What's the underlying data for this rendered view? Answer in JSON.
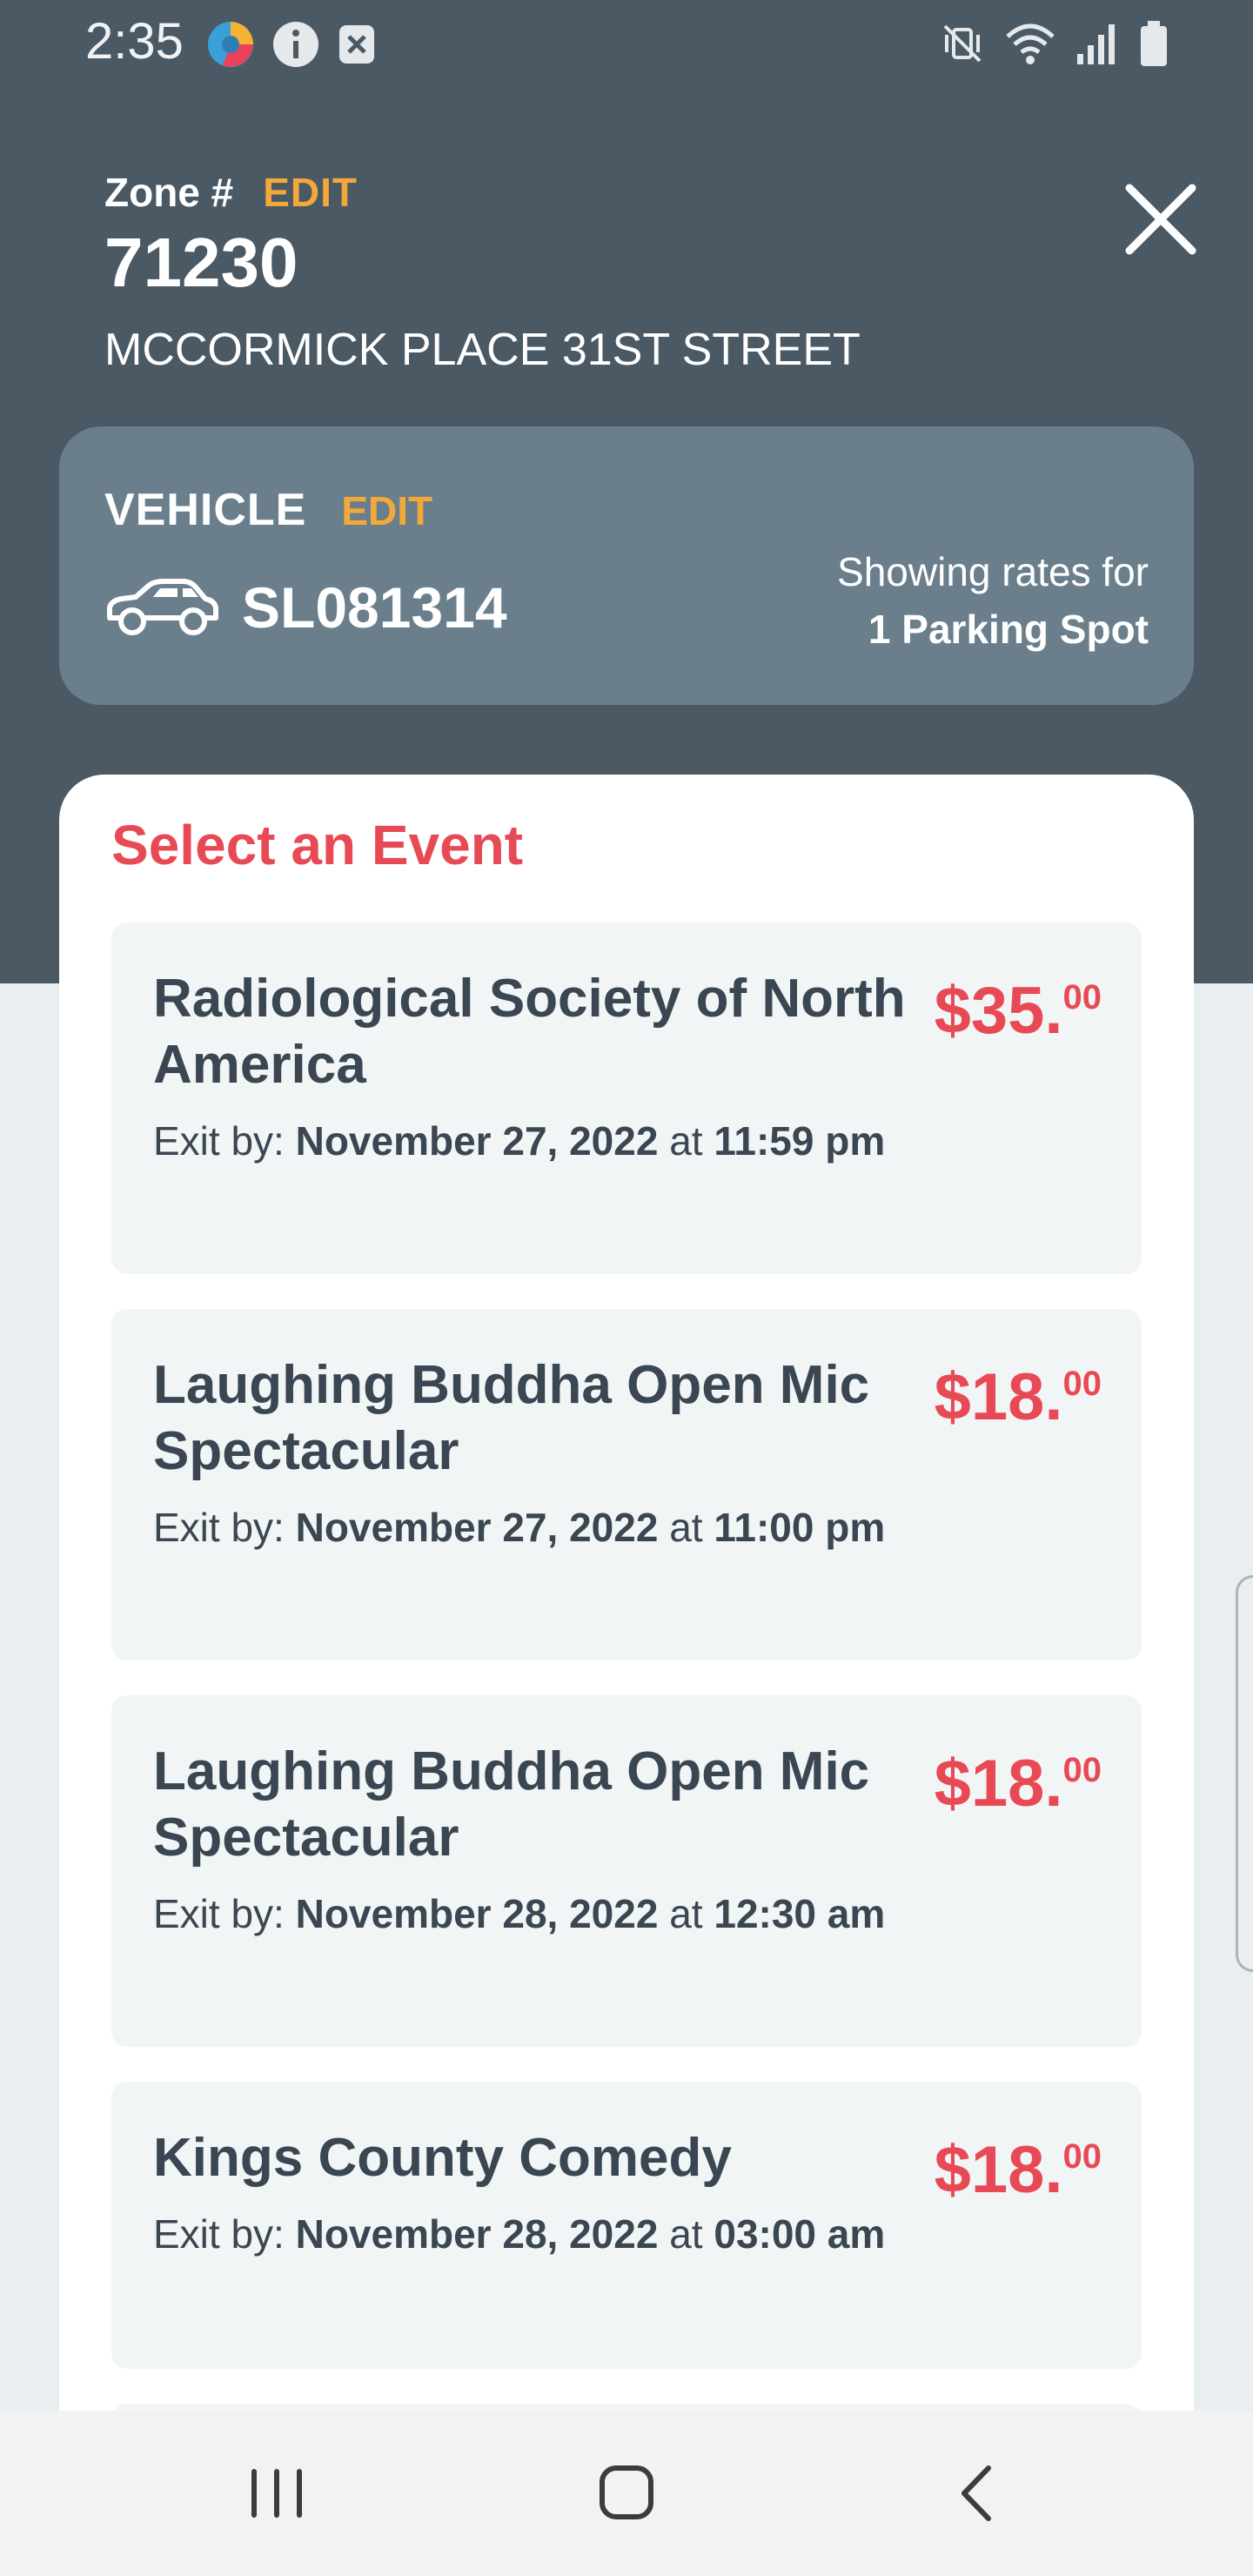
{
  "status_bar": {
    "time": "2:35"
  },
  "zone": {
    "label": "Zone #",
    "edit_label": "EDIT",
    "number": "71230",
    "location": "MCCORMICK PLACE 31ST STREET"
  },
  "vehicle": {
    "label": "VEHICLE",
    "edit_label": "EDIT",
    "plate": "SL081314",
    "rates_line1": "Showing rates for",
    "rates_line2": "1 Parking Spot"
  },
  "events": {
    "title": "Select an Event",
    "exit_prefix": "Exit by:",
    "at_word": "at",
    "items": [
      {
        "name": "Radiological Society of North America",
        "price_main": "$35.",
        "price_cents": "00",
        "exit_date": "November 27, 2022",
        "exit_time": "11:59 pm"
      },
      {
        "name": "Laughing Buddha Open Mic Spectacular",
        "price_main": "$18.",
        "price_cents": "00",
        "exit_date": "November 27, 2022",
        "exit_time": "11:00 pm"
      },
      {
        "name": "Laughing Buddha Open Mic Spectacular",
        "price_main": "$18.",
        "price_cents": "00",
        "exit_date": "November 28, 2022",
        "exit_time": "12:30 am"
      },
      {
        "name": "Kings County Comedy",
        "price_main": "$18.",
        "price_cents": "00",
        "exit_date": "November 28, 2022",
        "exit_time": "03:00 am"
      }
    ]
  },
  "icons": {
    "close": "close-icon",
    "car": "car-icon",
    "nav_recents": "recent-apps-icon",
    "nav_home": "home-icon",
    "nav_back": "back-icon"
  },
  "colors": {
    "header_bg": "#4b5965",
    "vehicle_card": "#6a7f8b",
    "accent_orange": "#f3a93a",
    "price_red": "#e84a55",
    "text_dark": "#3a4651"
  }
}
